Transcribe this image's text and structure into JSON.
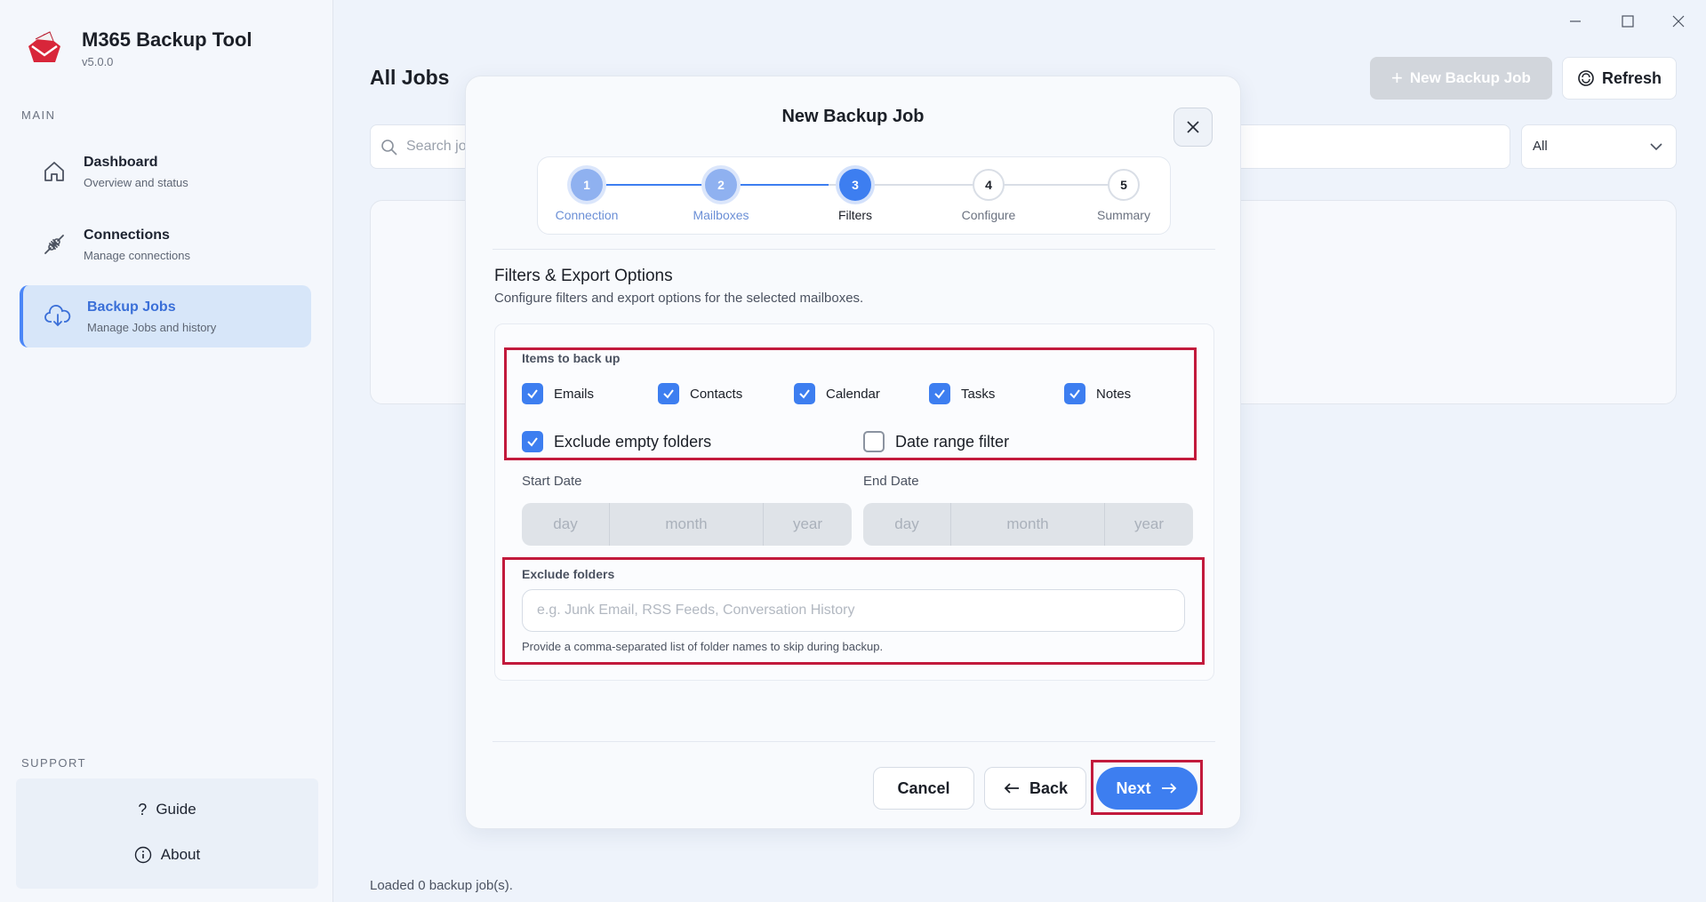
{
  "app": {
    "title": "M365 Backup Tool",
    "version": "v5.0.0"
  },
  "sidebar": {
    "main_label": "MAIN",
    "items": [
      {
        "title": "Dashboard",
        "subtitle": "Overview and status"
      },
      {
        "title": "Connections",
        "subtitle": "Manage connections"
      },
      {
        "title": "Backup Jobs",
        "subtitle": "Manage Jobs and history"
      }
    ],
    "support_label": "SUPPORT",
    "support": [
      {
        "label": "Guide"
      },
      {
        "label": "About"
      }
    ]
  },
  "main": {
    "title": "All Jobs",
    "search_placeholder": "Search jo",
    "filter_value": "All",
    "new_job_label": "New Backup Job",
    "refresh_label": "Refresh",
    "status": "Loaded 0 backup job(s)."
  },
  "modal": {
    "title": "New Backup Job",
    "steps": [
      {
        "number": "1",
        "label": "Connection",
        "state": "done"
      },
      {
        "number": "2",
        "label": "Mailboxes",
        "state": "done"
      },
      {
        "number": "3",
        "label": "Filters",
        "state": "active"
      },
      {
        "number": "4",
        "label": "Configure",
        "state": "pending"
      },
      {
        "number": "5",
        "label": "Summary",
        "state": "pending"
      }
    ],
    "section_title": "Filters & Export Options",
    "section_subtitle": "Configure filters and export options for the selected mailboxes.",
    "items_label": "Items to back up",
    "items": [
      {
        "label": "Emails",
        "checked": true
      },
      {
        "label": "Contacts",
        "checked": true
      },
      {
        "label": "Calendar",
        "checked": true
      },
      {
        "label": "Tasks",
        "checked": true
      },
      {
        "label": "Notes",
        "checked": true
      }
    ],
    "exclude_empty": {
      "label": "Exclude empty folders",
      "checked": true
    },
    "date_range": {
      "label": "Date range filter",
      "checked": false
    },
    "start_date": {
      "label": "Start Date",
      "day": "day",
      "month": "month",
      "year": "year"
    },
    "end_date": {
      "label": "End Date",
      "day": "day",
      "month": "month",
      "year": "year"
    },
    "exclude_folders": {
      "label": "Exclude folders",
      "placeholder": "e.g. Junk Email, RSS Feeds, Conversation History",
      "help": "Provide a comma-separated list of folder names to skip during backup."
    },
    "buttons": {
      "cancel": "Cancel",
      "back": "Back",
      "next": "Next"
    }
  },
  "colors": {
    "accent": "#3d7ef0",
    "highlight": "#c21a3c",
    "logo": "#d8263a"
  }
}
